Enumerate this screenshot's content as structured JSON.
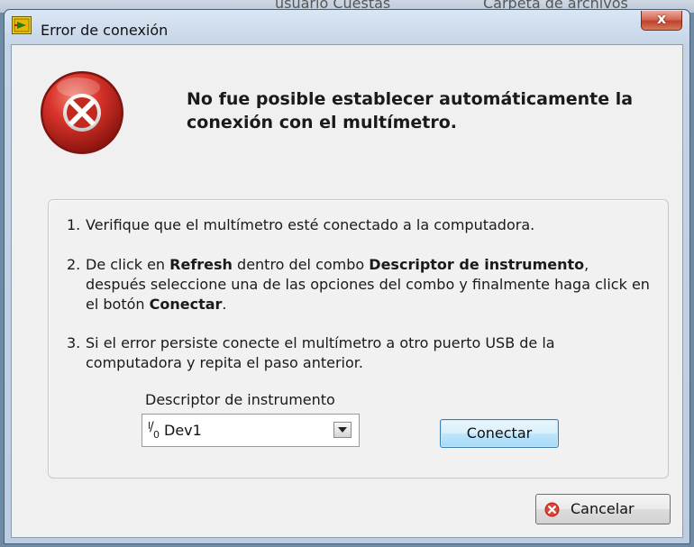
{
  "background": {
    "fragment_left": "usuario Cuestas",
    "fragment_right": "Carpeta de archivos"
  },
  "window": {
    "title": "Error de conexión",
    "close_glyph": "x"
  },
  "message": {
    "headline_line1": "No fue posible establecer automáticamente la",
    "headline_line2": "conexión con el multímetro."
  },
  "steps": [
    {
      "number": "1.",
      "parts": [
        "Verifique que el multímetro esté conectado a la computadora."
      ]
    },
    {
      "number": "2.",
      "parts": [
        "De click en ",
        "Refresh",
        " dentro del combo ",
        "Descriptor de instrumento",
        ", después seleccione una de las opciones del combo y finalmente haga click en el botón ",
        "Conectar",
        "."
      ]
    },
    {
      "number": "3.",
      "parts": [
        "Si el error persiste conecte el multímetro a otro puerto USB de la computadora y repita el paso anterior."
      ]
    }
  ],
  "descriptor": {
    "label": "Descriptor de instrumento",
    "io_glyph_top": "I",
    "io_glyph_bottom": "0",
    "value": "Dev1"
  },
  "buttons": {
    "connect": "Conectar",
    "cancel": "Cancelar"
  },
  "colors": {
    "error_red": "#d9342b",
    "connect_border": "#3c7fb1"
  },
  "icons": {
    "title": "labview-icon",
    "error": "error-x-icon",
    "cancel": "cancel-x-icon",
    "dropdown": "dropdown-arrow-icon"
  }
}
